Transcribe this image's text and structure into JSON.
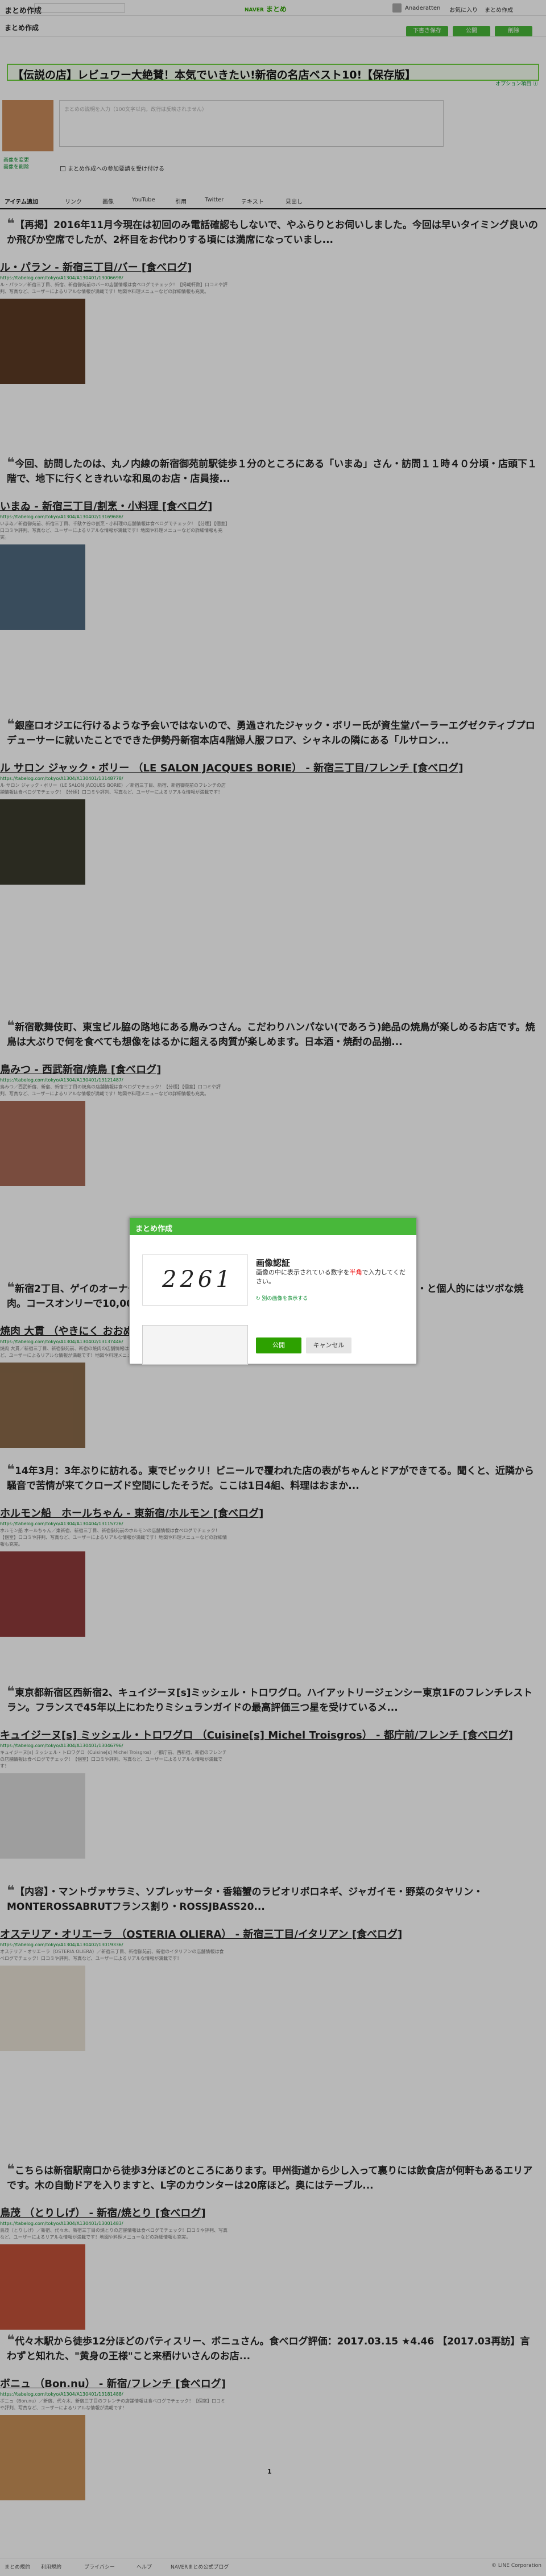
{
  "topbar": {
    "app_title": "まとめ作成",
    "search_placeholder": "",
    "brand_sub": "NAVER",
    "brand": "まとめ",
    "user_name": "Anaderatten",
    "links": [
      "お気に入り",
      "まとめ作成"
    ]
  },
  "subbar": {
    "title": "まとめ作成",
    "btn_draft": "下書き保存",
    "btn_publish": "公開",
    "btn_delete": "削除"
  },
  "editor": {
    "title": "【伝説の店】レビュワー大絶賛！本気でいきたい!新宿の名店ベスト10!【保存版】",
    "option_link": "オプション項目 ⓘ",
    "description_placeholder": "まとめの説明を入力（100文字以内。改行は反映されません）",
    "thumb_link": "画像を変更\n画像を削除",
    "checkbox_label": "まとめ作成への参加要請を受け付ける"
  },
  "tabs": [
    "アイテム追加",
    "リンク",
    "画像",
    "YouTube",
    "引用",
    "Twitter",
    "テキスト",
    "見出し"
  ],
  "items": [
    {
      "quote": "【再掲】2016年11月今現在は初回のみ電話確認もしないで、やふらりとお伺いしました。今回は早いタイミング良いのか飛びか空席でしたが、2杯目をお代わりする頃には満席になっていまし...",
      "link": "ル・パラン - 新宿三丁目/バー [食べログ]",
      "url": "https://tabelog.com/tokyo/A1304/A130401/13006698/",
      "text": "ル・パラン／新宿三丁目、新宿、新宿御苑前のバーの店舗情報は食べログでチェック！【掲載軒数】口コミや評判、写真など、ユーザーによるリアルな情報が満載です！地図や料理メニューなどの詳細情報も充実。"
    },
    {
      "quote": "今回、訪問したのは、丸ノ内線の新宿御苑前駅徒歩１分のところにある「いまゐ」さん・訪問１１時４０分頃・店頭下１階で、地下に行くときれいな和風のお店・店員接...",
      "link": "いまゐ - 新宿三丁目/割烹・小料理 [食べログ]",
      "url": "https://tabelog.com/tokyo/A1304/A130402/13169686/",
      "text": "いまゐ／新宿御苑前、新宿三丁目、千駄ケ谷の割烹・小料理の店舗情報は食べログでチェック！【分煙】【個室】口コミや評判、写真など、ユーザーによるリアルな情報が満載です！地図や料理メニューなどの詳細情報も充実。"
    },
    {
      "quote": "銀座ロオジエに行けるような予会いではないので、勇過されたジャック・ボリー氏が資生堂パーラーエグゼクティブプロデューサーに就いたことでできた伊勢丹新宿本店4階婦人服フロア、シャネルの隣にある「ルサロン...",
      "link": "ル サロン ジャック・ボリー （LE SALON JACQUES BORIE） - 新宿三丁目/フレンチ [食べログ]",
      "url": "https://tabelog.com/tokyo/A1304/A130401/13148778/",
      "text": "ル サロン ジャック・ボリー（LE SALON JACQUES BORIE）／新宿三丁目、新宿、新宿御苑前のフレンチの店舗情報は食べログでチェック！【分煙】口コミや評判、写真など、ユーザーによるリアルな情報が満載です！"
    },
    {
      "quote": "新宿歌舞伎町、東宝ビル脇の路地にある鳥みつさん。こだわりハンパない(であろう)絶品の焼鳥が楽しめるお店です。焼鳥は大ぶりで何を食べても想像をはるかに超える肉質が楽しめます。日本酒・焼酎の品揃...",
      "link": "鳥みつ - 西武新宿/焼鳥 [食べログ]",
      "url": "https://tabelog.com/tokyo/A1304/A130401/13121487/",
      "text": "鳥みつ／西武新宿、新宿、新宿三丁目の焼鳥の店舗情報は食べログでチェック！【分煙】【個室】口コミや評判、写真など、ユーザーによるリアルな情報が満載です！地図や料理メニューなどの詳細情報も充実。"
    },
    {
      "quote": "新宿2丁目、ゲイのオーナーが営む焼肉店。極薄のタン、独特なタレの肉、うまずぎる米・・・と個人的にはツボな焼肉。コースオンリーで10,000円、12,000円、15,000円とあるが、10,00...",
      "link": "焼肉 大貫 （やきにく おおぬき） - 新宿三丁目/焼肉 [食べログ]",
      "url": "https://tabelog.com/tokyo/A1304/A130402/13137446/",
      "text": "焼肉 大貫／新宿三丁目、新宿御苑前、新宿の焼肉の店舗情報は食べログでチェック！口コミや評判、写真など、ユーザーによるリアルな情報が満載です！地図や料理メニューなどの詳細情報も充実。"
    },
    {
      "quote": "14年3月：3年ぶりに訪れる。東でビックリ！ビニールで覆われた店の表がちゃんとドアができてる。聞くと、近隣から騒音で苦情が来てクローズド空間にしたそうだ。ここは1日4組、料理はおまか...",
      "link": "ホルモン船　ホールちゃん - 東新宿/ホルモン [食べログ]",
      "url": "https://tabelog.com/tokyo/A1304/A130404/13115726/",
      "text": "ホルモン船 ホールちゃん／東新宿、新宿三丁目、新宿御苑前のホルモンの店舗情報は食べログでチェック！【個室】口コミや評判、写真など、ユーザーによるリアルな情報が満載です！地図や料理メニューなどの詳細情報も充実。"
    },
    {
      "quote": "東京都新宿区西新宿2、キュイジーヌ[s]ミッシェル・トロワグロ。ハイアットリージェンシー東京1Fのフレンチレストラン。フランスで45年以上にわたりミシュランガイドの最高評価三つ星を受けているメ...",
      "link": "キュイジーヌ[s] ミッシェル・トロワグロ （Cuisine[s] Michel Troisgros） - 都庁前/フレンチ [食べログ]",
      "url": "https://tabelog.com/tokyo/A1304/A130401/13046796/",
      "text": "キュイジーヌ[s] ミッシェル・トロワグロ（Cuisine[s] Michel Troisgros）／都庁前、西新宿、新宿のフレンチの店舗情報は食べログでチェック！【個室】口コミや評判、写真など、ユーザーによるリアルな情報が満載です！"
    },
    {
      "quote": "【内容】・マントヴァサラミ、ソプレッサータ・香箱蟹のラビオリボロネギ、ジャガイモ・野菜のタヤリン・MONTEROSSABRUTフランス割り・ROSSJBASS20...",
      "link": "オステリア・オリエーラ （OSTERIA OLIERA） - 新宿三丁目/イタリアン [食べログ]",
      "url": "https://tabelog.com/tokyo/A1304/A130402/13019336/",
      "text": "オステリア・オリエーラ（OSTERIA OLIERA）／新宿三丁目、新宿御苑前、新宿のイタリアンの店舗情報は食べログでチェック！口コミや評判、写真など、ユーザーによるリアルな情報が満載です！"
    },
    {
      "quote": "こちらは新宿駅南口から徒歩3分ほどのところにあります。甲州街道から少し入って裏りには飲食店が何軒もあるエリアです。木の自動ドアを入りますと、L字のカウンターは20席ほど。奥にはテーブル...",
      "link": "鳥茂 （とりしげ） - 新宿/焼とり [食べログ]",
      "url": "https://tabelog.com/tokyo/A1304/A130401/13001483/",
      "text": "鳥茂（とりしげ）／新宿、代々木、新宿三丁目の焼とりの店舗情報は食べログでチェック！口コミや評判、写真など、ユーザーによるリアルな情報が満載です！地図や料理メニューなどの詳細情報も充実。"
    },
    {
      "quote": "代々木駅から徒歩12分ほどのパティスリー、ボニュさん。食べログ評価：2017.03.15 ★4.46 【2017.03再訪】言わずと知れた、\"黄身の王様\"こと来栖けいさんのお店...",
      "link": "ボニュ （Bon.nu） - 新宿/フレンチ [食べログ]",
      "url": "https://tabelog.com/tokyo/A1304/A130401/13181488/",
      "text": "ボニュ（Bon.nu）／新宿、代々木、新宿三丁目のフレンチの店舗情報は食べログでチェック！【個室】口コミや評判、写真など、ユーザーによるリアルな情報が満載です！"
    }
  ],
  "pager": "1",
  "modal": {
    "header": "まとめ作成",
    "captcha_text": "2261",
    "title": "画像認証",
    "text_before": "画像の中に表示されている数字を",
    "text_em": "半角",
    "text_after": "で入力してください。",
    "refresh_link": "別の画像を表示する",
    "ok": "公開",
    "cancel": "キャンセル"
  },
  "footer": {
    "links": [
      "まとめ規約",
      "利用規約",
      "プライバシー",
      "ヘルプ",
      "NAVERまとめ公式ブログ"
    ],
    "copyright": "© LINE Corporation"
  },
  "colors": {
    "accent": "#48b83a",
    "link": "#0a8c2f",
    "warn": "#ee0000"
  }
}
